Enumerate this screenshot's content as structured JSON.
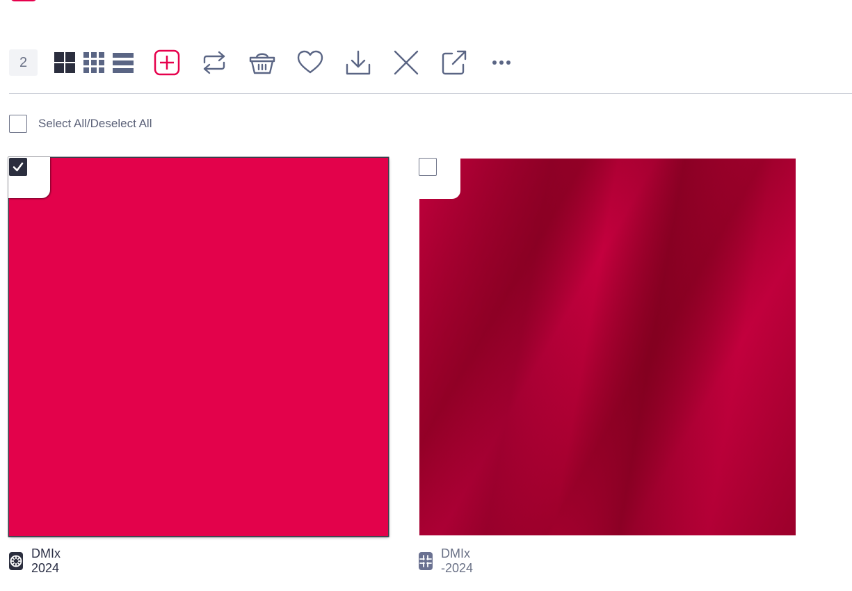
{
  "toolbar": {
    "selected_count": "2",
    "icons": [
      "large-grid-icon",
      "small-grid-icon",
      "list-view-icon",
      "add-icon",
      "share-icon",
      "basket-icon",
      "heart-icon",
      "download-icon",
      "close-icon",
      "open-external-icon",
      "more-icon"
    ]
  },
  "select_all": {
    "label": "Select All/Deselect All",
    "checked": false
  },
  "assets": [
    {
      "title": "DMIx 2024",
      "checked": true,
      "type_icon": "aperture-icon"
    },
    {
      "title": "DMIx -2024",
      "checked": false,
      "type_icon": "crop-icon"
    }
  ],
  "colors": {
    "accent": "#e6004c",
    "dark": "#2b2e3e",
    "icon": "#5a6584",
    "swatch": "#e3024b"
  }
}
